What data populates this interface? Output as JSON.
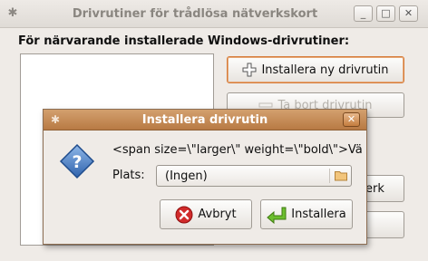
{
  "main_window": {
    "title": "Drivrutiner för trådlösa nätverkskort",
    "heading": "För närvarande installerade Windows-drivrutiner:",
    "install_new_label": "Installera ny drivrutin",
    "remove_label": "Ta bort drivrutin",
    "partial_button_label": "erk",
    "wm_buttons": {
      "minimize": "_",
      "maximize": "□",
      "close": "✕"
    }
  },
  "dialog": {
    "title": "Installera drivrutin",
    "message": "<span size=\\\"larger\\\" weight=\\\"bold\\\">Vä",
    "location_label": "Plats:",
    "location_value": "(Ingen)",
    "cancel_label": "Avbryt",
    "ok_label": "Installera"
  },
  "colors": {
    "dialog_titlebar": "#c48a54",
    "focus_border": "#d77c3a",
    "question_icon": "#3b6fb6",
    "cancel_icon": "#d12b2b",
    "ok_icon": "#4e9a06"
  }
}
